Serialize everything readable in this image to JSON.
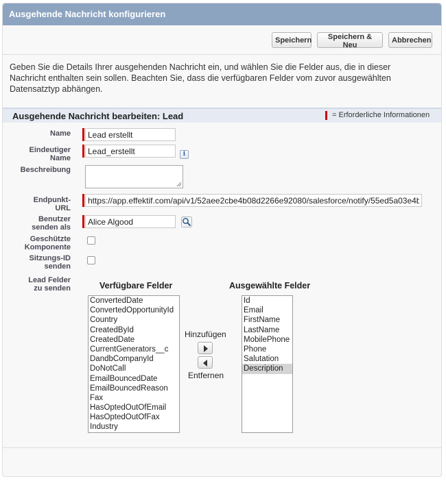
{
  "header": {
    "title": "Ausgehende Nachricht konfigurieren"
  },
  "toolbar": {
    "save": "Speichern",
    "save_new": "Speichern & Neu",
    "cancel": "Abbrechen"
  },
  "intro_text": "Geben Sie die Details Ihrer ausgehenden Nachricht ein, und wählen Sie die Felder aus, die in dieser Nachricht enthalten sein sollen. Beachten Sie, dass die verfügbaren Felder vom zuvor ausgewählten Datensatztyp abhängen.",
  "section": {
    "title": "Ausgehende Nachricht bearbeiten: Lead",
    "required_legend": "= Erforderliche Informationen"
  },
  "form": {
    "name_label": "Name",
    "name_value": "Lead erstellt",
    "unique_name_label_1": "Eindeutiger",
    "unique_name_label_2": "Name",
    "unique_name_value": "Lead_erstellt",
    "description_label": "Beschreibung",
    "endpoint_label_1": "Endpunkt-",
    "endpoint_label_2": "URL",
    "endpoint_value": "https://app.effektif.com/api/v1/52aee2cbe4b08d2266e92080/salesforce/notify/55ed5a03e4b",
    "user_label_1": "Benutzer",
    "user_label_2": "senden als",
    "user_value": "Alice Algood",
    "protected_label_1": "Geschützte",
    "protected_label_2": "Komponente",
    "session_label_1": "Sitzungs-ID",
    "session_label_2": "senden",
    "fields_label_1": "Lead Felder",
    "fields_label_2": "zu senden"
  },
  "multiselect": {
    "available_title": "Verfügbare Felder",
    "selected_title": "Ausgewählte Felder",
    "add_label": "Hinzufügen",
    "remove_label": "Entfernen",
    "available": [
      "ConvertedDate",
      "ConvertedOpportunityId",
      "Country",
      "CreatedById",
      "CreatedDate",
      "CurrentGenerators__c",
      "DandbCompanyId",
      "DoNotCall",
      "EmailBouncedDate",
      "EmailBouncedReason",
      "Fax",
      "HasOptedOutOfEmail",
      "HasOptedOutOfFax",
      "Industry"
    ],
    "selected": [
      "Id",
      "Email",
      "FirstName",
      "LastName",
      "MobilePhone",
      "Phone",
      "Salutation",
      "Description"
    ],
    "selected_highlight": "Description"
  },
  "colors": {
    "header": "#8da4c1",
    "required": "#cc0000",
    "section_bar": "#e6ebf3"
  }
}
